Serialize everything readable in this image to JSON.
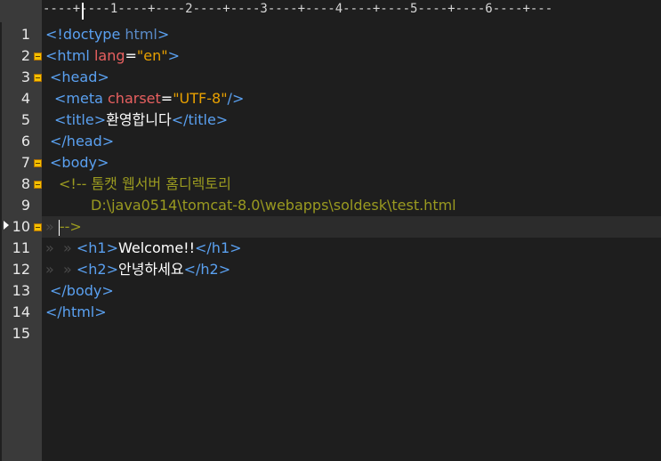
{
  "ruler": {
    "text": "----+----1----+----2----+----3----+----4----+----5----+----6----+---"
  },
  "gutter": {
    "line_numbers": [
      "1",
      "2",
      "3",
      "4",
      "5",
      "6",
      "7",
      "8",
      "9",
      "10",
      "11",
      "12",
      "13",
      "14",
      "15"
    ],
    "fold_markers_on_lines": [
      "2",
      "3",
      "7",
      "8",
      "10"
    ],
    "bookmark_line": "10",
    "current_line": "10"
  },
  "code": {
    "l1": {
      "open": "<!doctype",
      "kw": " html",
      "close": ">"
    },
    "l2": {
      "open": "<html",
      "attr": " lang",
      "eq": "=",
      "val": "\"en\"",
      "close": ">"
    },
    "l3": {
      "tag": "<head>"
    },
    "l4": {
      "open": "<meta",
      "attr": " charset",
      "eq": "=",
      "val": "\"UTF-8\"",
      "close": "/>"
    },
    "l5": {
      "open": "<title>",
      "text": "환영합니다",
      "close": "</title>"
    },
    "l6": {
      "tag": "</head>"
    },
    "l7": {
      "tag": "<body>"
    },
    "l8": {
      "comment": "<!-- 톰캣 웹서버 홈디렉토리"
    },
    "l9": {
      "comment": "D:\\java0514\\tomcat-8.0\\webapps\\soldesk\\test.html"
    },
    "l10": {
      "ws": "» ",
      "comment": "-->"
    },
    "l11": {
      "ws": "»  » ",
      "open": "<h1>",
      "text": "Welcome!!",
      "close": "</h1>"
    },
    "l12": {
      "ws": "»  » ",
      "open": "<h2>",
      "text": "안녕하세요",
      "close": "</h2>"
    },
    "l13": {
      "tag": "</body>"
    },
    "l14": {
      "tag": "</html>"
    },
    "l15": {}
  }
}
